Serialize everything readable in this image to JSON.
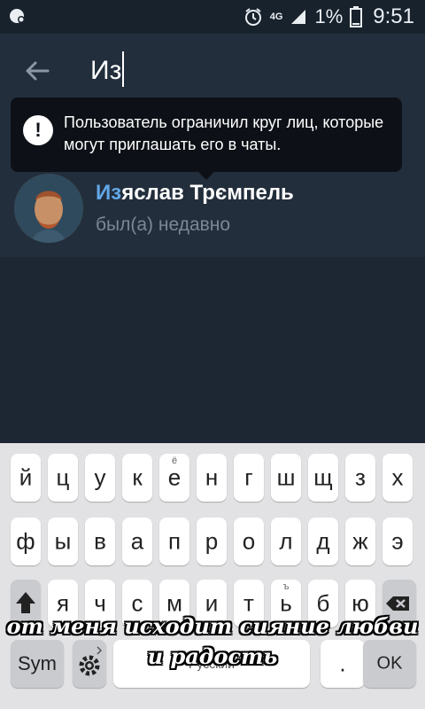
{
  "status_bar": {
    "network": "4G",
    "battery_percent": "1%",
    "time": "9:51"
  },
  "search": {
    "query": "Из"
  },
  "tooltip": {
    "text": "Пользователь ограничил круг лиц, которые могут приглашать его в чаты."
  },
  "result": {
    "name_highlight": "Из",
    "name_rest": "яслав Трємпель",
    "status": "был(а) недавно"
  },
  "keyboard": {
    "row1": [
      {
        "k": "й"
      },
      {
        "k": "ц"
      },
      {
        "k": "у"
      },
      {
        "k": "к"
      },
      {
        "k": "е",
        "hint": "ё"
      },
      {
        "k": "н"
      },
      {
        "k": "г"
      },
      {
        "k": "ш"
      },
      {
        "k": "щ"
      },
      {
        "k": "з"
      },
      {
        "k": "х"
      }
    ],
    "row2": [
      {
        "k": "ф"
      },
      {
        "k": "ы"
      },
      {
        "k": "в"
      },
      {
        "k": "а"
      },
      {
        "k": "п"
      },
      {
        "k": "р"
      },
      {
        "k": "о"
      },
      {
        "k": "л"
      },
      {
        "k": "д"
      },
      {
        "k": "ж"
      },
      {
        "k": "э"
      }
    ],
    "row3": [
      {
        "k": "я"
      },
      {
        "k": "ч"
      },
      {
        "k": "с"
      },
      {
        "k": "м"
      },
      {
        "k": "и"
      },
      {
        "k": "т"
      },
      {
        "k": "ь",
        "hint": "ъ"
      },
      {
        "k": "б"
      },
      {
        "k": "ю"
      }
    ],
    "sym_label": "Sym",
    "space_label": "Русский",
    "period_label": ".",
    "ok_label": "OK"
  },
  "overlay": {
    "caption": "от меня исходит сияние любви и радость"
  },
  "colors": {
    "accent": "#62a8e8",
    "background": "#1d2733",
    "surface": "#232e3c"
  }
}
